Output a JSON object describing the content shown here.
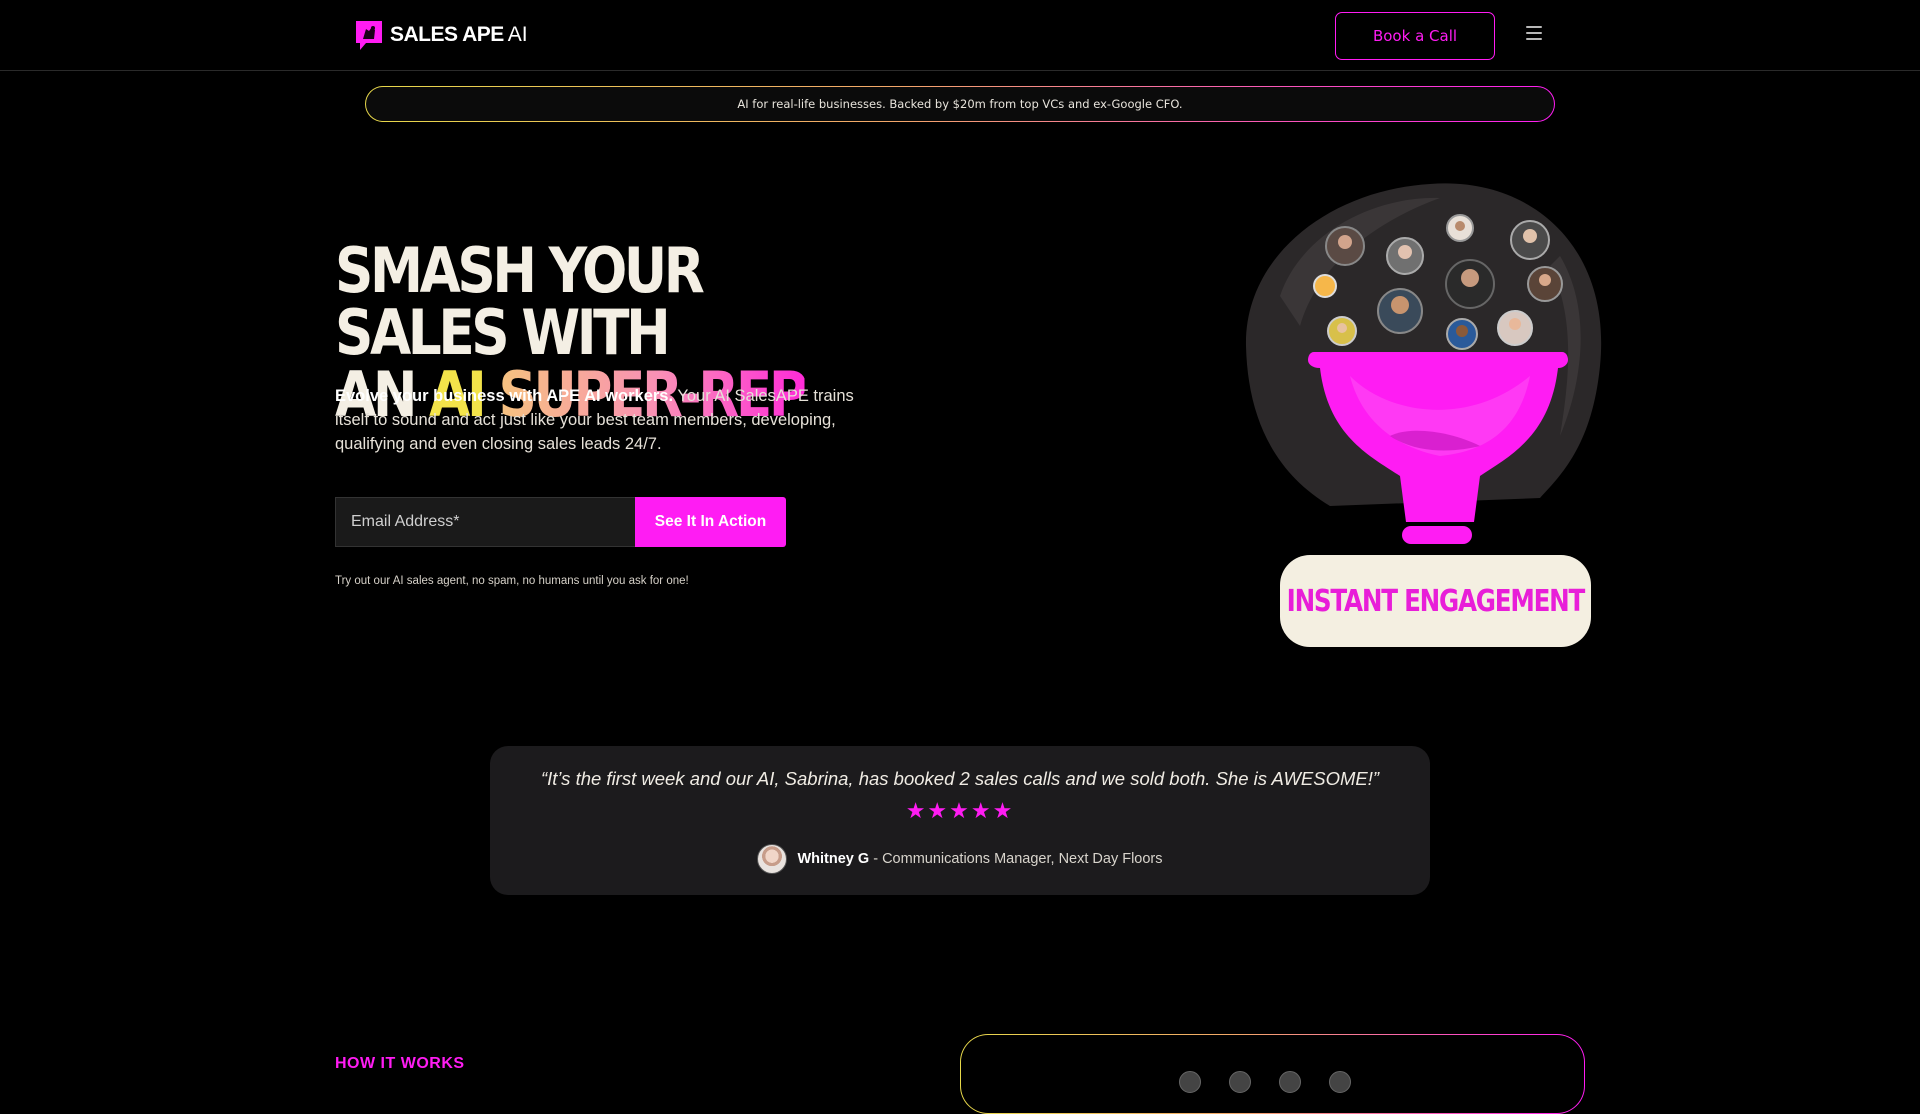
{
  "nav": {
    "logo_text": "SALES APE",
    "logo_suffix": "AI",
    "book_call_label": "Book a Call"
  },
  "banner": {
    "text": "AI for real-life businesses. Backed by $20m from top VCs and ex-Google CFO."
  },
  "hero": {
    "title_line1": "SMASH YOUR SALES WITH",
    "title_an": "AN ",
    "title_ai": "AI",
    "title_rest": " SUPER-REP",
    "desc_bold": "Evolve your business with APE AI workers.",
    "desc_rest": " Your AI SalesAPE trains itself to sound and act just like your best team members, developing, qualifying and even closing sales leads 24/7.",
    "email_placeholder": "Email Address*",
    "cta_label": "See It In Action",
    "note": "Try out our AI sales agent, no spam, no humans until you ask for one!",
    "illustration_label": "INSTANT ENGAGEMENT"
  },
  "testimonial": {
    "quote": "“It’s the first week and our AI, Sabrina, has booked 2 sales calls and we sold both. She is AWESOME!”",
    "stars": "★★★★★",
    "rating": 5,
    "name": "Whitney G",
    "role": " - Communications Manager, Next Day Floors"
  },
  "section": {
    "how_it_works": "HOW IT WORKS"
  },
  "colors": {
    "accent": "#ff1cf3",
    "background": "#000000",
    "cream": "#f4efe1",
    "yellow": "#f3e34a"
  }
}
